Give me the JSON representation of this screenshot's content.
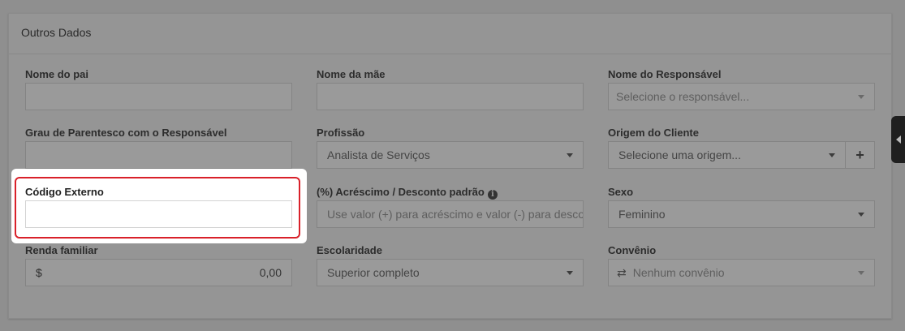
{
  "panel": {
    "title": "Outros Dados"
  },
  "fields": {
    "nome_pai": {
      "label": "Nome do pai",
      "value": ""
    },
    "nome_mae": {
      "label": "Nome da mãe",
      "value": ""
    },
    "responsavel": {
      "label": "Nome do Responsável",
      "placeholder": "Selecione o responsável..."
    },
    "grau_parentesco": {
      "label": "Grau de Parentesco com o Responsável",
      "value": ""
    },
    "profissao": {
      "label": "Profissão",
      "value": "Analista de Serviços"
    },
    "origem": {
      "label": "Origem do Cliente",
      "placeholder": "Selecione uma origem...",
      "add_label": "+"
    },
    "codigo_externo": {
      "label": "Código Externo",
      "value": ""
    },
    "acrescimo": {
      "label": "(%) Acréscimo / Desconto padrão",
      "placeholder": "Use valor (+) para acréscimo e valor (-) para desconto"
    },
    "sexo": {
      "label": "Sexo",
      "value": "Feminino"
    },
    "renda": {
      "label": "Renda familiar",
      "currency": "$",
      "value": "0,00"
    },
    "escolaridade": {
      "label": "Escolaridade",
      "value": "Superior completo"
    },
    "convenio": {
      "label": "Convênio",
      "icon": "swap-arrows-icon",
      "placeholder": "Nenhum convênio"
    }
  },
  "colors": {
    "highlight_border": "#d9212a",
    "overlay": "#8f8f8f"
  }
}
